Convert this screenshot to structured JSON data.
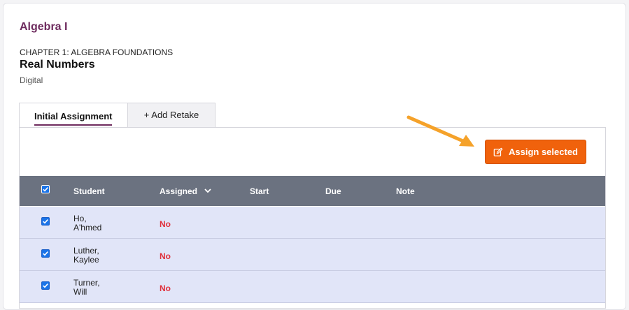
{
  "course": {
    "title": "Algebra I"
  },
  "lesson": {
    "chapter": "CHAPTER 1: ALGEBRA FOUNDATIONS",
    "title": "Real Numbers",
    "type": "Digital"
  },
  "tabs": [
    {
      "label": "Initial Assignment",
      "active": true
    },
    {
      "label": "+ Add Retake",
      "active": false
    }
  ],
  "actions": {
    "assign_selected": "Assign selected",
    "icon": "edit-icon"
  },
  "table": {
    "columns": [
      "Student",
      "Assigned",
      "Start",
      "Due",
      "Note"
    ],
    "select_all_checked": true,
    "rows": [
      {
        "last": "Ho,",
        "first": "A'hmed",
        "assigned": "No",
        "checked": true
      },
      {
        "last": "Luther,",
        "first": "Kaylee",
        "assigned": "No",
        "checked": true
      },
      {
        "last": "Turner,",
        "first": "Will",
        "assigned": "No",
        "checked": true
      }
    ]
  },
  "colors": {
    "brand": "#6e2b5e",
    "action": "#f0620c",
    "header": "#6b7280",
    "row": "#e1e5f8",
    "status_no": "#e0313c",
    "arrow": "#f5a22a"
  }
}
